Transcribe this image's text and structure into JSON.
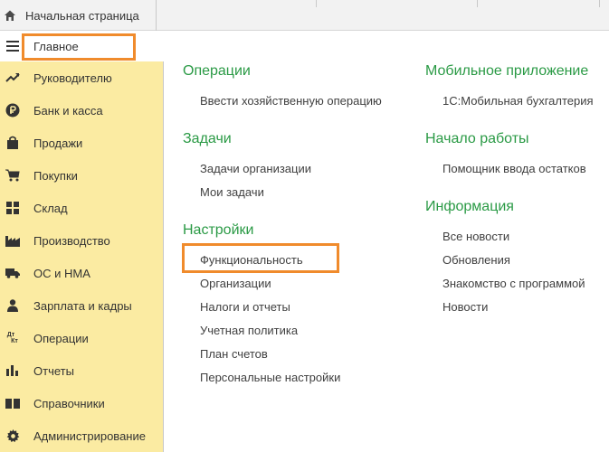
{
  "top_tabs": {
    "home_label": "Начальная страница"
  },
  "sidebar": {
    "items": [
      {
        "label": "Главное",
        "icon": "menu-lines-icon"
      },
      {
        "label": "Руководителю",
        "icon": "trend-chart-icon"
      },
      {
        "label": "Банк и касса",
        "icon": "ruble-coin-icon"
      },
      {
        "label": "Продажи",
        "icon": "shopping-bag-icon"
      },
      {
        "label": "Покупки",
        "icon": "shopping-cart-icon"
      },
      {
        "label": "Склад",
        "icon": "warehouse-grid-icon"
      },
      {
        "label": "Производство",
        "icon": "factory-icon"
      },
      {
        "label": "ОС и НМА",
        "icon": "truck-icon"
      },
      {
        "label": "Зарплата и кадры",
        "icon": "person-icon"
      },
      {
        "label": "Операции",
        "icon": "debit-credit-icon"
      },
      {
        "label": "Отчеты",
        "icon": "bar-chart-icon"
      },
      {
        "label": "Справочники",
        "icon": "book-icon"
      },
      {
        "label": "Администрирование",
        "icon": "gear-icon"
      }
    ],
    "dtkt_top": "Дт",
    "dtkt_bottom": "Кт"
  },
  "main": {
    "left": {
      "operations": {
        "title": "Операции",
        "links": [
          "Ввести хозяйственную операцию"
        ]
      },
      "tasks": {
        "title": "Задачи",
        "links": [
          "Задачи организации",
          "Мои задачи"
        ]
      },
      "settings": {
        "title": "Настройки",
        "links": [
          "Функциональность",
          "Организации",
          "Налоги и отчеты",
          "Учетная политика",
          "План счетов",
          "Персональные настройки"
        ]
      }
    },
    "right": {
      "mobile": {
        "title": "Мобильное приложение",
        "links": [
          "1С:Мобильная бухгалтерия"
        ]
      },
      "start": {
        "title": "Начало работы",
        "links": [
          "Помощник ввода остатков"
        ]
      },
      "info": {
        "title": "Информация",
        "links": [
          "Все новости",
          "Обновления",
          "Знакомство с программой",
          "Новости"
        ]
      }
    }
  },
  "colors": {
    "sidebar_bg": "#fbeba2",
    "group_title": "#2a9a45",
    "highlight": "#f08b2c"
  }
}
